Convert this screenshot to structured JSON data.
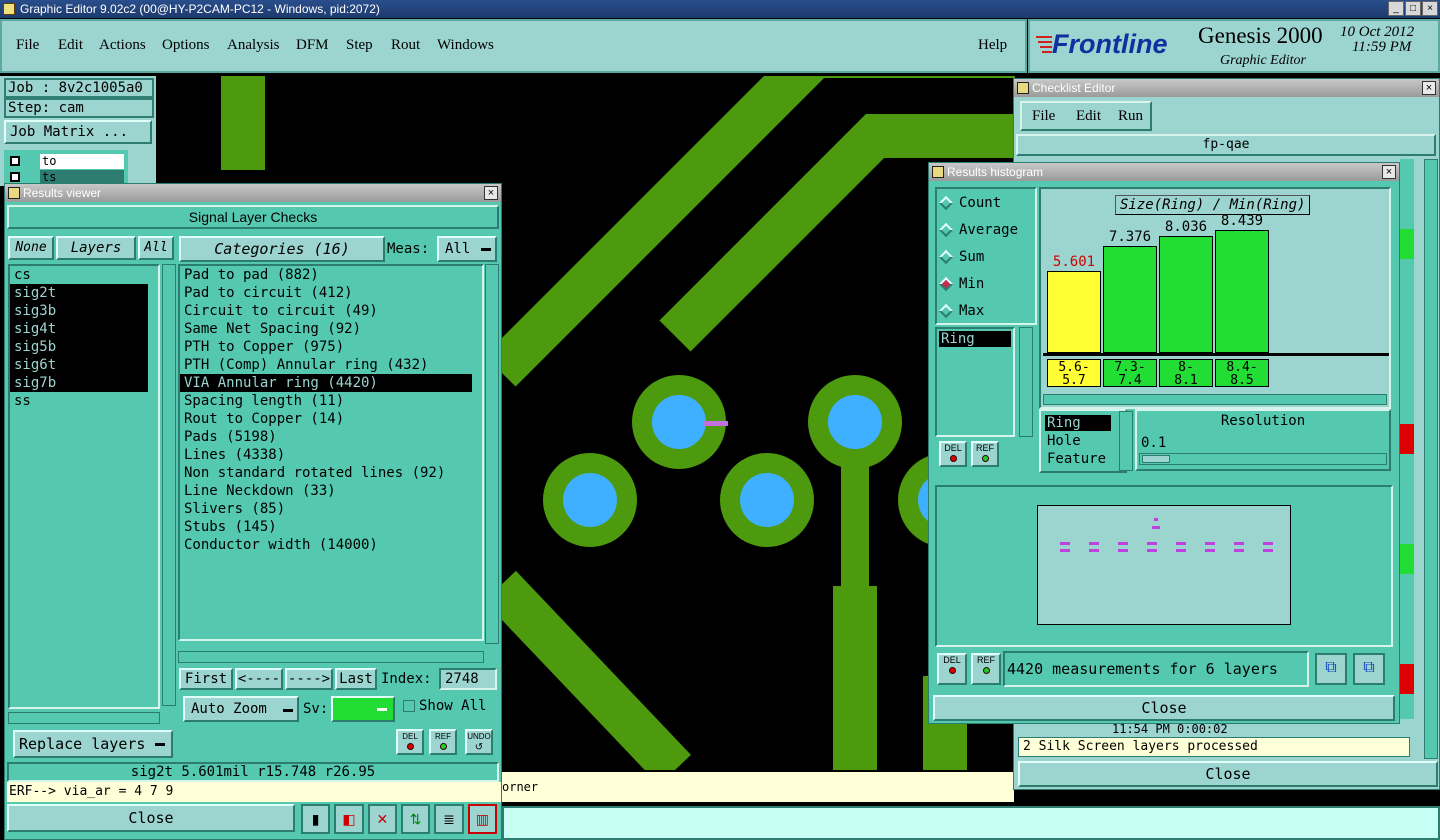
{
  "window_title": "Graphic Editor 9.02c2 (00@HY-P2CAM-PC12 - Windows, pid:2072)",
  "menu": [
    "File",
    "Edit",
    "Actions",
    "Options",
    "Analysis",
    "DFM",
    "Step",
    "Rout",
    "Windows"
  ],
  "help": "Help",
  "brand": {
    "logo": "Frontline",
    "product": "Genesis 2000",
    "subtitle": "Graphic Editor",
    "date": "10 Oct 2012",
    "time": "11:59 PM"
  },
  "job": {
    "job_label": "Job : 8v2c1005a0",
    "step_label": "Step: cam",
    "job_matrix": "Job Matrix ..."
  },
  "layer_mini": [
    "to",
    "ts"
  ],
  "results_viewer": {
    "title": "Results viewer",
    "header": "Signal Layer Checks",
    "none_btn": "None",
    "layers_btn": "Layers",
    "all_btn": "All",
    "layers": [
      {
        "name": "cs",
        "sel": false
      },
      {
        "name": "sig2t",
        "sel": true
      },
      {
        "name": "sig3b",
        "sel": true
      },
      {
        "name": "sig4t",
        "sel": true
      },
      {
        "name": "sig5b",
        "sel": true
      },
      {
        "name": "sig6t",
        "sel": true
      },
      {
        "name": "sig7b",
        "sel": true
      },
      {
        "name": "ss",
        "sel": false
      }
    ],
    "categories_btn": "Categories (16)",
    "meas_label": "Meas:",
    "meas_value": "All",
    "categories": [
      {
        "label": "Pad to pad (882)",
        "sel": false
      },
      {
        "label": "Pad to circuit (412)",
        "sel": false
      },
      {
        "label": "Circuit to circuit (49)",
        "sel": false
      },
      {
        "label": "Same Net Spacing (92)",
        "sel": false
      },
      {
        "label": "PTH to Copper (975)",
        "sel": false
      },
      {
        "label": "PTH (Comp) Annular ring (432)",
        "sel": false
      },
      {
        "label": "VIA Annular ring (4420)",
        "sel": true
      },
      {
        "label": "Spacing length (11)",
        "sel": false
      },
      {
        "label": "Rout to Copper (14)",
        "sel": false
      },
      {
        "label": "Pads (5198)",
        "sel": false
      },
      {
        "label": "Lines (4338)",
        "sel": false
      },
      {
        "label": "Non standard rotated lines (92)",
        "sel": false
      },
      {
        "label": "Line Neckdown (33)",
        "sel": false
      },
      {
        "label": "Slivers (85)",
        "sel": false
      },
      {
        "label": "Stubs (145)",
        "sel": false
      },
      {
        "label": "Conductor width (14000)",
        "sel": false
      }
    ],
    "first": "First",
    "prev": "<----",
    "next": "---->",
    "last": "Last",
    "index_label": "Index:",
    "index_value": "2748",
    "auto_zoom": "Auto Zoom",
    "sv_label": "Sv:",
    "show_all": "Show All",
    "replace_layers": "Replace layers",
    "del": "DEL",
    "ref": "REF",
    "undo": "UNDO",
    "status": "sig2t 5.601mil  r15.748  r26.95",
    "erf": "ERF--> via_ar = 4 7 9",
    "close": "Close"
  },
  "checklist": {
    "title": "Checklist Editor",
    "menu": [
      "File",
      "Edit",
      "Run"
    ],
    "name": "fp-qae",
    "log_time": "11:54 PM   0:00:02",
    "log_line": "2 Silk Screen layers processed",
    "close": "Close"
  },
  "histogram": {
    "title": "Results histogram",
    "modes": [
      {
        "label": "Count",
        "on": false
      },
      {
        "label": "Average",
        "on": false
      },
      {
        "label": "Sum",
        "on": false
      },
      {
        "label": "Min",
        "on": true
      },
      {
        "label": "Max",
        "on": false
      }
    ],
    "list_item": "Ring",
    "types": [
      "Ring",
      "Hole",
      "Feature"
    ],
    "resolution_label": "Resolution",
    "resolution_value": "0.1",
    "measurements": "4420 measurements for 6 layers",
    "close": "Close",
    "del": "DEL",
    "ref": "REF",
    "colors": {
      "yellow": "#ffff33",
      "green": "#22dd33",
      "labels_red": "#d00000"
    }
  },
  "chart_data": {
    "type": "bar",
    "title": "Size(Ring) / Min(Ring)",
    "categories": [
      "5.6-5.7",
      "7.3-7.4",
      "8-8.1",
      "8.4-8.5"
    ],
    "category_labels": [
      [
        "5.6-",
        "5.7"
      ],
      [
        "7.3-",
        "7.4"
      ],
      [
        "8-",
        "8.1"
      ],
      [
        "8.4-",
        "8.5"
      ]
    ],
    "values": [
      5.601,
      7.376,
      8.036,
      8.439
    ],
    "value_labels": [
      "5.601",
      "7.376",
      "8.036",
      "8.439"
    ],
    "ylim": [
      0,
      9.2
    ],
    "highlight_index": 0
  },
  "bottom_text": "orner"
}
